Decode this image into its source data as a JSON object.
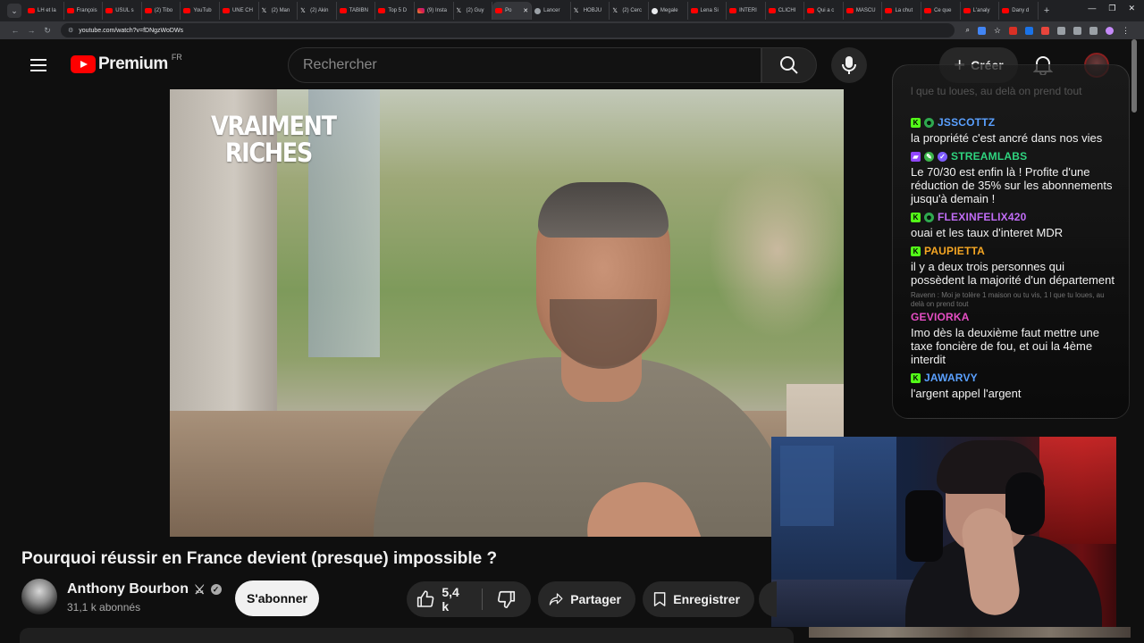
{
  "browser": {
    "tabs": [
      {
        "label": "LH et la",
        "icon": "youtube"
      },
      {
        "label": "François",
        "icon": "youtube"
      },
      {
        "label": "USUL s",
        "icon": "youtube"
      },
      {
        "label": "(2) Tibo",
        "icon": "youtube"
      },
      {
        "label": "YouTub",
        "icon": "youtube"
      },
      {
        "label": "UNE CH",
        "icon": "youtube"
      },
      {
        "label": "(2) Man",
        "icon": "x"
      },
      {
        "label": "(2) Akin",
        "icon": "x"
      },
      {
        "label": "TABIBN",
        "icon": "youtube"
      },
      {
        "label": "Top 5 D",
        "icon": "youtube"
      },
      {
        "label": "(9) Insta",
        "icon": "instagram"
      },
      {
        "label": "(2) Guy",
        "icon": "x"
      },
      {
        "label": "Po",
        "icon": "youtube",
        "active": true
      },
      {
        "label": "Lancer",
        "icon": "grey"
      },
      {
        "label": "HOBJU",
        "icon": "x"
      },
      {
        "label": "(2) Cerc",
        "icon": "x"
      },
      {
        "label": "Megale",
        "icon": "github"
      },
      {
        "label": "Lena Si",
        "icon": "youtube"
      },
      {
        "label": "INTERI",
        "icon": "youtube"
      },
      {
        "label": "CLICHI",
        "icon": "youtube"
      },
      {
        "label": "Qui a c",
        "icon": "youtube"
      },
      {
        "label": "MASCU",
        "icon": "youtube"
      },
      {
        "label": "La chut",
        "icon": "youtube"
      },
      {
        "label": "Ce que",
        "icon": "youtube"
      },
      {
        "label": "L'analy",
        "icon": "youtube"
      },
      {
        "label": "Dany d",
        "icon": "youtube"
      }
    ],
    "url": "youtube.com/watch?v=fDNgzWoDWs"
  },
  "header": {
    "logo_text": "Premium",
    "country": "FR",
    "search_placeholder": "Rechercher",
    "create_label": "Créer"
  },
  "video": {
    "overlay_title_line1": "VRAIMENT",
    "overlay_title_line2": "RICHES",
    "title": "Pourquoi réussir en France devient (presque) impossible ?"
  },
  "channel": {
    "name": "Anthony Bourbon",
    "subscribers": "31,1 k abonnés",
    "subscribe_label": "S'abonner"
  },
  "actions": {
    "likes": "5,4 k",
    "share_label": "Partager",
    "save_label": "Enregistrer"
  },
  "chat": {
    "ghost_text": "l que tu loues, au delà on prend tout",
    "messages": [
      {
        "user": "JSSCOTTZ",
        "color": "#5aa0ff",
        "badges": [
          "k",
          "mod"
        ],
        "text": "la propriété c'est ancré dans nos vies"
      },
      {
        "user": "STREAMLABS",
        "color": "#2fd47f",
        "badges": [
          "tw",
          "pen",
          "ver"
        ],
        "text": "Le 70/30 est enfin là ! Profite d'une réduction de 35% sur les abonnements jusqu'à demain !"
      },
      {
        "user": "FLEXINFELIX420",
        "color": "#c06cf5",
        "badges": [
          "k",
          "mod"
        ],
        "text": "ouai et les taux d'interet MDR"
      },
      {
        "user": "PAUPIETTA",
        "color": "#f5a623",
        "badges": [
          "k"
        ],
        "text": "il y a deux trois personnes qui possèdent la majorité d'un département"
      },
      {
        "user": "GEVIORKA",
        "color": "#e64ec4",
        "badges": [],
        "reply": "Ravenn : Moi je tolère 1 maison ou tu vis, 1 l que tu loues, au delà on prend tout",
        "text": "Imo dès la deuxième faut mettre une taxe foncière de fou, et oui la 4ème interdit"
      },
      {
        "user": "JAWARVY",
        "color": "#5aa0ff",
        "badges": [
          "k"
        ],
        "text": "l'argent appel l'argent"
      }
    ]
  }
}
